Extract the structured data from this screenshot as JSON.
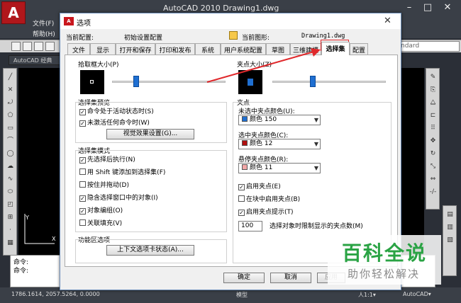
{
  "app": {
    "title": "AutoCAD 2010    Drawing1.dwg",
    "logo": "A",
    "menu": [
      "文件(F)",
      "帮助(H)"
    ],
    "window_controls": [
      "–",
      "□",
      "✕"
    ],
    "standard_combo": "ndard",
    "workspace_combo": "AutoCAD 经典",
    "command_lines": [
      "命令:",
      "命令:"
    ],
    "status": {
      "coords": "1786.1614, 2057.5264, 0.0000",
      "model": "模型",
      "scale": "人1:1▾",
      "workspace": "AutoCAD▾"
    }
  },
  "dialog": {
    "title": "选项",
    "close": "✕",
    "current_profile_label": "当前配置:",
    "current_profile_value": "初始设置配置",
    "current_drawing_label": "当前图形:",
    "current_drawing_value": "Drawing1.dwg",
    "tabs": [
      "文件",
      "显示",
      "打开和保存",
      "打印和发布",
      "系统",
      "用户系统配置",
      "草图",
      "三维建模",
      "选择集",
      "配置"
    ],
    "active_tab": "选择集",
    "pickbox": {
      "label": "拾取框大小(P)",
      "level": 0.2
    },
    "gripsize": {
      "label": "夹点大小(Z)",
      "level": 0.35
    },
    "selection_preview": {
      "label": "选择集预览",
      "options": [
        {
          "label": "命令处于活动状态时(S)",
          "checked": true
        },
        {
          "label": "未激活任何命令时(W)",
          "checked": true
        }
      ],
      "button": "视觉效果设置(G)..."
    },
    "selection_modes": {
      "label": "选择集模式",
      "options": [
        {
          "label": "先选择后执行(N)",
          "checked": true
        },
        {
          "label": "用 Shift 键添加到选择集(F)",
          "checked": false
        },
        {
          "label": "按住并拖动(D)",
          "checked": false
        },
        {
          "label": "隐含选择窗口中的对象(I)",
          "checked": true
        },
        {
          "label": "对象编组(O)",
          "checked": true
        },
        {
          "label": "关联填充(V)",
          "checked": false
        }
      ]
    },
    "ribbon": {
      "label": "功能区选项",
      "button": "上下文选项卡状态(A)..."
    },
    "grips": {
      "label": "夹点",
      "unselected_label": "未选中夹点颜色(U):",
      "unselected_value": "颜色 150",
      "unselected_color": "#1f6fd1",
      "selected_label": "选中夹点颜色(C):",
      "selected_value": "颜色 12",
      "selected_color": "#b01010",
      "hover_label": "悬停夹点颜色(R):",
      "hover_value": "颜色 11",
      "hover_color": "#f3a7a7",
      "options": [
        {
          "label": "启用夹点(E)",
          "checked": true
        },
        {
          "label": "在块中启用夹点(B)",
          "checked": false
        },
        {
          "label": "启用夹点提示(T)",
          "checked": true
        }
      ],
      "limit_value": "100",
      "limit_label": "选择对象时限制显示的夹点数(M)"
    },
    "ok": "确定",
    "cancel": "取消",
    "apply": "应用"
  },
  "watermark": {
    "title": "百科全说",
    "subtitle": "助你轻松解决"
  }
}
